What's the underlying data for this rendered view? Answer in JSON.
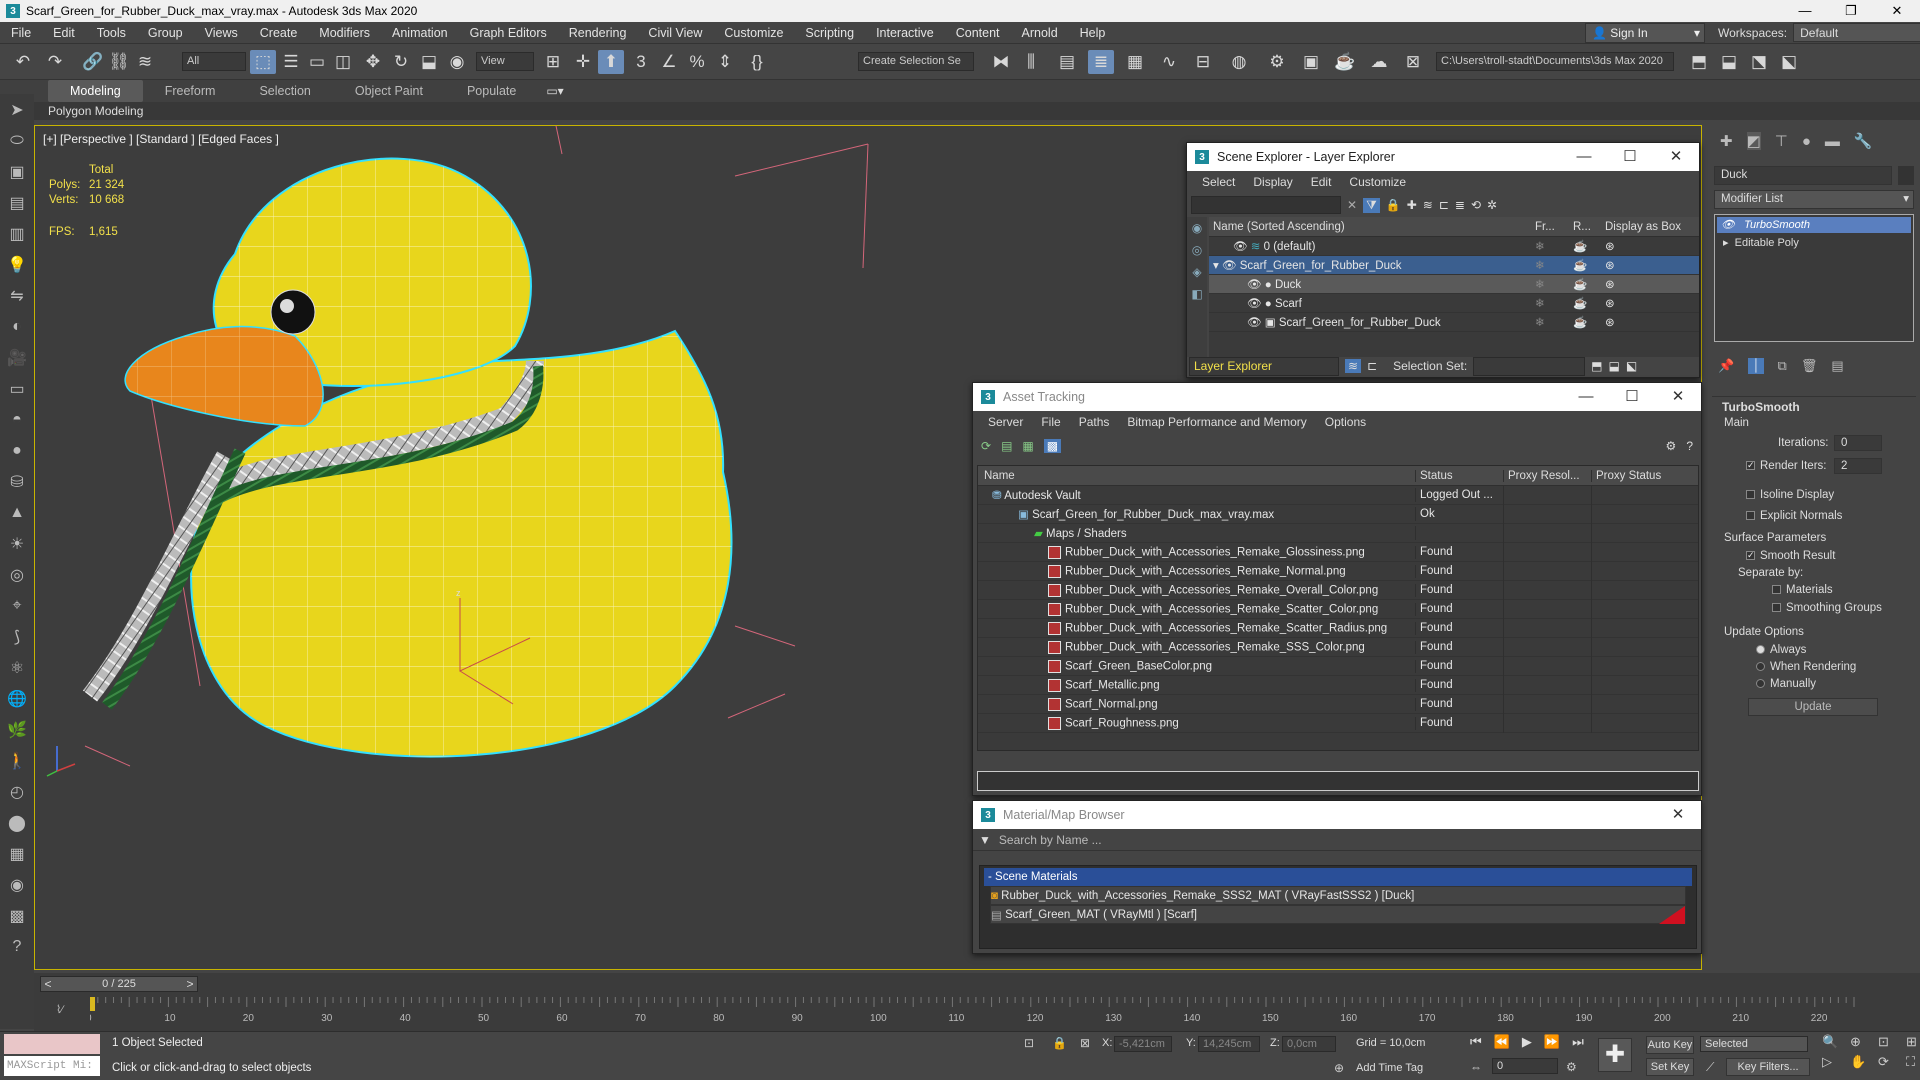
{
  "window": {
    "title": "Scarf_Green_for_Rubber_Duck_max_vray.max - Autodesk 3ds Max 2020"
  },
  "menu": [
    "File",
    "Edit",
    "Tools",
    "Group",
    "Views",
    "Create",
    "Modifiers",
    "Animation",
    "Graph Editors",
    "Rendering",
    "Civil View",
    "Customize",
    "Scripting",
    "Interactive",
    "Content",
    "Arnold",
    "Help"
  ],
  "account": {
    "signin": "Sign In",
    "workspaces_label": "Workspaces:",
    "workspace": "Default"
  },
  "toolbar": {
    "filter": "All",
    "view": "View",
    "selection_set": "Create Selection Se",
    "path": "C:\\Users\\troll-stadt\\Documents\\3ds Max 2020"
  },
  "ribbon": {
    "tabs": [
      "Modeling",
      "Freeform",
      "Selection",
      "Object Paint",
      "Populate"
    ],
    "sub": "Polygon Modeling"
  },
  "viewport": {
    "label": "[+] [Perspective ] [Standard ] [Edged Faces ]",
    "total_label": "Total",
    "polys_label": "Polys:",
    "polys": "21 324",
    "verts_label": "Verts:",
    "verts": "10 668",
    "fps_label": "FPS:",
    "fps": "1,615"
  },
  "scene_explorer": {
    "title": "Scene Explorer - Layer Explorer",
    "menu": [
      "Select",
      "Display",
      "Edit",
      "Customize"
    ],
    "cols": [
      "Name (Sorted Ascending)",
      "Fr...",
      "R...",
      "Display as Box"
    ],
    "rows": [
      "0 (default)",
      "Scarf_Green_for_Rubber_Duck",
      "Duck",
      "Scarf",
      "Scarf_Green_for_Rubber_Duck"
    ],
    "footer_mode": "Layer Explorer",
    "selection_set_label": "Selection Set:"
  },
  "asset_tracking": {
    "title": "Asset Tracking",
    "menu": [
      "Server",
      "File",
      "Paths",
      "Bitmap Performance and Memory",
      "Options"
    ],
    "cols": [
      "Name",
      "Status",
      "Proxy Resol...",
      "Proxy Status"
    ],
    "rows": [
      {
        "name": "Autodesk Vault",
        "status": "Logged Out ..."
      },
      {
        "name": "Scarf_Green_for_Rubber_Duck_max_vray.max",
        "status": "Ok"
      },
      {
        "name": "Maps / Shaders",
        "status": ""
      },
      {
        "name": "Rubber_Duck_with_Accessories_Remake_Glossiness.png",
        "status": "Found"
      },
      {
        "name": "Rubber_Duck_with_Accessories_Remake_Normal.png",
        "status": "Found"
      },
      {
        "name": "Rubber_Duck_with_Accessories_Remake_Overall_Color.png",
        "status": "Found"
      },
      {
        "name": "Rubber_Duck_with_Accessories_Remake_Scatter_Color.png",
        "status": "Found"
      },
      {
        "name": "Rubber_Duck_with_Accessories_Remake_Scatter_Radius.png",
        "status": "Found"
      },
      {
        "name": "Rubber_Duck_with_Accessories_Remake_SSS_Color.png",
        "status": "Found"
      },
      {
        "name": "Scarf_Green_BaseColor.png",
        "status": "Found"
      },
      {
        "name": "Scarf_Metallic.png",
        "status": "Found"
      },
      {
        "name": "Scarf_Normal.png",
        "status": "Found"
      },
      {
        "name": "Scarf_Roughness.png",
        "status": "Found"
      }
    ]
  },
  "material_browser": {
    "title": "Material/Map Browser",
    "search_placeholder": "Search by Name ...",
    "section": "- Scene Materials",
    "items": [
      "Rubber_Duck_with_Accessories_Remake_SSS2_MAT ( VRayFastSSS2 ) [Duck]",
      "Scarf_Green_MAT ( VRayMtl ) [Scarf]"
    ]
  },
  "command_panel": {
    "object_name": "Duck",
    "modifier_list": "Modifier List",
    "stack": [
      "TurboSmooth",
      "Editable Poly"
    ],
    "rollout": "TurboSmooth",
    "main": "Main",
    "iterations_label": "Iterations:",
    "iterations": "0",
    "render_iters_label": "Render Iters:",
    "render_iters": "2",
    "isoline": "Isoline Display",
    "explicit": "Explicit Normals",
    "surface_params": "Surface Parameters",
    "smooth_result": "Smooth Result",
    "separate_by": "Separate by:",
    "materials": "Materials",
    "smoothing_groups": "Smoothing Groups",
    "update_options": "Update Options",
    "always": "Always",
    "when_rendering": "When Rendering",
    "manually": "Manually",
    "update": "Update"
  },
  "timeline": {
    "frame": "0 / 225",
    "ticks": [
      "0",
      "10",
      "20",
      "30",
      "40",
      "50",
      "60",
      "70",
      "80",
      "90",
      "100",
      "110",
      "120",
      "130",
      "140",
      "150",
      "160",
      "170",
      "180",
      "190",
      "200",
      "210",
      "220"
    ]
  },
  "status": {
    "maxscript": "MAXScript Mi:",
    "selected": "1 Object Selected",
    "prompt": "Click or click-and-drag to select objects",
    "x_label": "X:",
    "x": "-5,421cm",
    "y_label": "Y:",
    "y": "14,245cm",
    "z_label": "Z:",
    "z": "0,0cm",
    "grid": "Grid = 10,0cm",
    "add_time_tag": "Add Time Tag",
    "auto_key": "Auto Key",
    "set_key": "Set Key",
    "selected_dd": "Selected",
    "key_filters": "Key Filters...",
    "frame_field": "0"
  }
}
